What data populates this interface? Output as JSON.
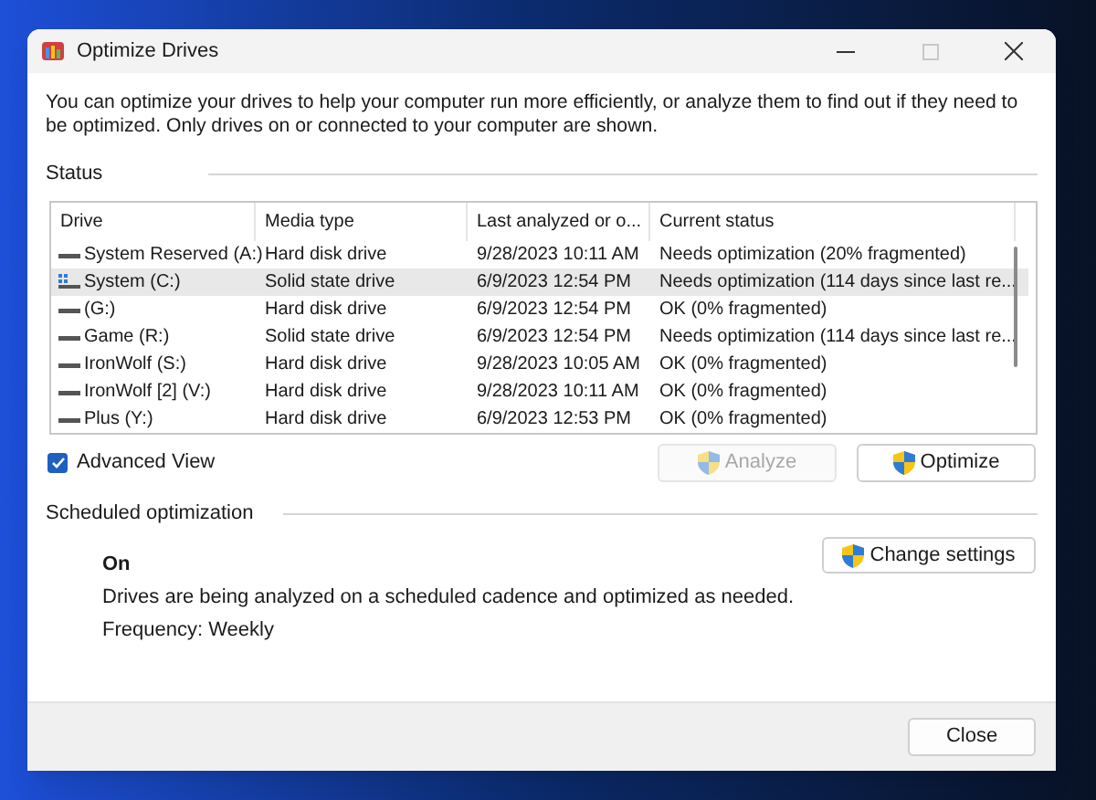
{
  "window": {
    "title": "Optimize Drives",
    "maximize_disabled": true
  },
  "intro": "You can optimize your drives to help your computer run more efficiently, or analyze them to find out if they need to be optimized. Only drives on or connected to your computer are shown.",
  "status": {
    "heading": "Status",
    "table": {
      "columns": [
        "Drive",
        "Media type",
        "Last analyzed or o...",
        "Current status"
      ],
      "rows": [
        {
          "kind": "hdd",
          "selected": false,
          "cells": [
            "System Reserved (A:)",
            "Hard disk drive",
            "9/28/2023 10:11 AM",
            "Needs optimization (20% fragmented)"
          ]
        },
        {
          "kind": "system",
          "selected": true,
          "cells": [
            "System (C:)",
            "Solid state drive",
            "6/9/2023 12:54 PM",
            "Needs optimization (114 days since last re..."
          ]
        },
        {
          "kind": "hdd",
          "selected": false,
          "cells": [
            "(G:)",
            "Hard disk drive",
            "6/9/2023 12:54 PM",
            "OK (0% fragmented)"
          ]
        },
        {
          "kind": "hdd",
          "selected": false,
          "cells": [
            "Game (R:)",
            "Solid state drive",
            "6/9/2023 12:54 PM",
            "Needs optimization (114 days since last re..."
          ]
        },
        {
          "kind": "hdd",
          "selected": false,
          "cells": [
            "IronWolf (S:)",
            "Hard disk drive",
            "9/28/2023 10:05 AM",
            "OK (0% fragmented)"
          ]
        },
        {
          "kind": "hdd",
          "selected": false,
          "cells": [
            "IronWolf [2] (V:)",
            "Hard disk drive",
            "9/28/2023 10:11 AM",
            "OK (0% fragmented)"
          ]
        },
        {
          "kind": "hdd",
          "selected": false,
          "cells": [
            "Plus (Y:)",
            "Hard disk drive",
            "6/9/2023 12:53 PM",
            "OK (0% fragmented)"
          ]
        }
      ]
    },
    "advanced_view": {
      "label": "Advanced View",
      "checked": true
    },
    "buttons": [
      {
        "label": "Analyze",
        "disabled": true
      },
      {
        "label": "Optimize",
        "disabled": false
      }
    ]
  },
  "scheduled": {
    "heading": "Scheduled optimization",
    "state": "On",
    "description": "Drives are being analyzed on a scheduled cadence and optimized as needed.",
    "frequency": "Frequency: Weekly",
    "button": "Change settings"
  },
  "footer": {
    "button": "Close"
  }
}
